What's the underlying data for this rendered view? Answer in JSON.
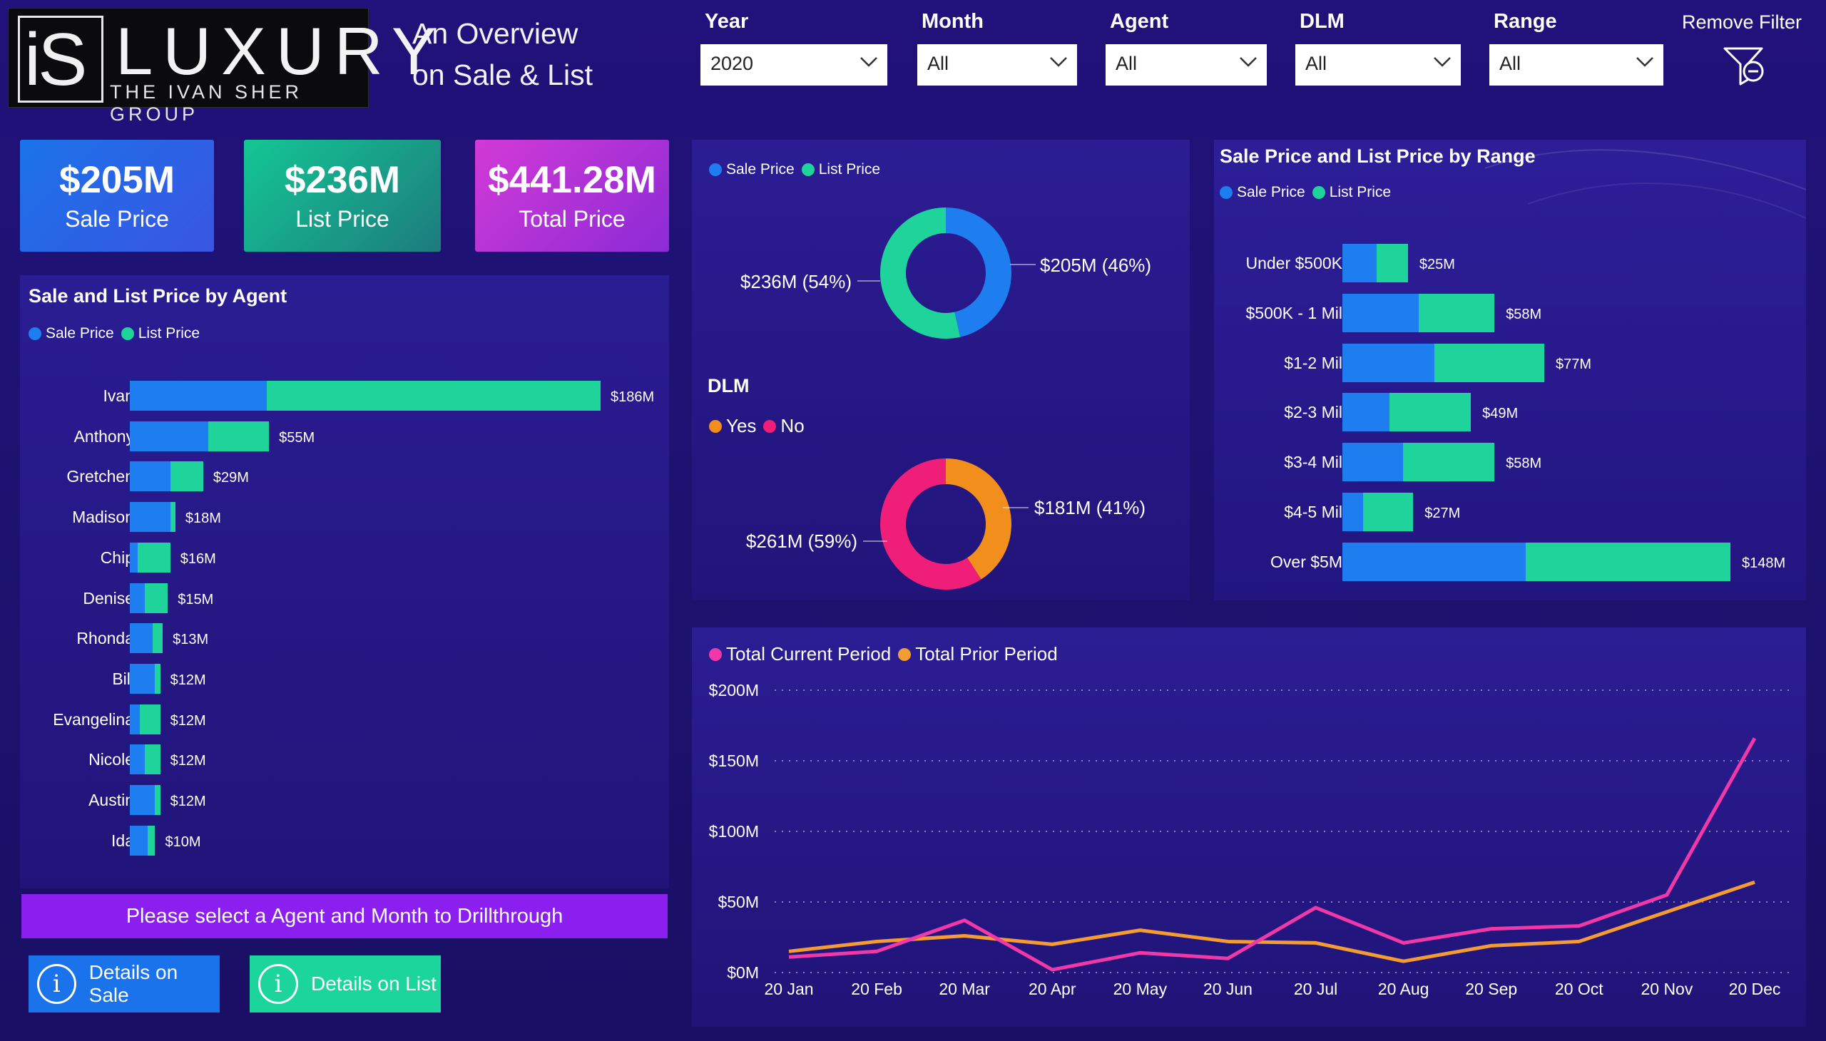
{
  "logo": {
    "mark": "iS",
    "name": "LUXURY",
    "subtitle": "THE IVAN SHER GROUP"
  },
  "header": {
    "title_line1": "An Overview",
    "title_line2": "on Sale & List"
  },
  "filters": [
    {
      "label": "Year",
      "value": "2020"
    },
    {
      "label": "Month",
      "value": "All"
    },
    {
      "label": "Agent",
      "value": "All"
    },
    {
      "label": "DLM",
      "value": "All"
    },
    {
      "label": "Range",
      "value": "All"
    }
  ],
  "remove_filter": {
    "label": "Remove Filter",
    "icon": "filter-remove-icon"
  },
  "kpis": [
    {
      "value": "$205M",
      "label": "Sale Price"
    },
    {
      "value": "$236M",
      "label": "List Price"
    },
    {
      "value": "$441.28M",
      "label": "Total Price"
    }
  ],
  "colors": {
    "sale": "#1e7ef0",
    "list": "#1fd49a",
    "yes": "#f28e1c",
    "no": "#ef1e78",
    "current": "#f038a8",
    "prior": "#f49b32",
    "cta": "#8a1ff0"
  },
  "agents_chart": {
    "title": "Sale and List Price by Agent",
    "legend": [
      "Sale Price",
      "List Price"
    ]
  },
  "price_donut": {
    "legend": [
      "Sale Price",
      "List Price"
    ]
  },
  "dlm_donut": {
    "title": "DLM",
    "legend": [
      "Yes",
      "No"
    ]
  },
  "range_chart": {
    "title": "Sale Price and List Price by Range",
    "legend": [
      "Sale Price",
      "List Price"
    ]
  },
  "line_legend": [
    "Total Current Period",
    "Total Prior Period"
  ],
  "cta": {
    "label": "Please select a Agent and Month to Drillthrough"
  },
  "buttons": {
    "sale": "Details on Sale",
    "list": "Details on List",
    "icon_glyph": "i"
  },
  "chart_data": [
    {
      "type": "bar",
      "title": "Sale and List Price by Agent",
      "orientation": "horizontal",
      "stacked": true,
      "categories": [
        "Ivan",
        "Anthony",
        "Gretchen",
        "Madison",
        "Chip",
        "Denise",
        "Rhonda",
        "Bill",
        "Evangelina",
        "Nicole",
        "Austin",
        "Ida"
      ],
      "series": [
        {
          "name": "Sale Price",
          "values": [
            54,
            31,
            16,
            16,
            3,
            6,
            9,
            10,
            4,
            6,
            10,
            7
          ]
        },
        {
          "name": "List Price",
          "values": [
            132,
            24,
            13,
            2,
            13,
            9,
            4,
            2,
            8,
            6,
            2,
            3
          ]
        }
      ],
      "totals": [
        "$186M",
        "$55M",
        "$29M",
        "$18M",
        "$16M",
        "$15M",
        "$13M",
        "$12M",
        "$12M",
        "$12M",
        "$12M",
        "$10M"
      ],
      "unit": "$M"
    },
    {
      "type": "pie",
      "donut": true,
      "legend": [
        "Sale Price",
        "List Price"
      ],
      "labels": [
        "Sale Price",
        "List Price"
      ],
      "values": [
        205,
        236
      ],
      "data_labels": [
        "$205M (46%)",
        "$236M (54%)"
      ]
    },
    {
      "type": "pie",
      "donut": true,
      "title": "DLM",
      "legend": [
        "Yes",
        "No"
      ],
      "labels": [
        "Yes",
        "No"
      ],
      "values": [
        181,
        261
      ],
      "data_labels": [
        "$181M (41%)",
        "$261M (59%)"
      ]
    },
    {
      "type": "bar",
      "title": "Sale Price and List Price by Range",
      "orientation": "horizontal",
      "stacked": true,
      "categories": [
        "Under $500K",
        "$500K - 1 Mil",
        "$1-2 Mil",
        "$2-3 Mil",
        "$3-4 Mil",
        "$4-5 Mil",
        "Over $5M"
      ],
      "series": [
        {
          "name": "Sale Price",
          "values": [
            13,
            29,
            35,
            18,
            23,
            8,
            70
          ]
        },
        {
          "name": "List Price",
          "values": [
            12,
            29,
            42,
            31,
            35,
            19,
            78
          ]
        }
      ],
      "totals": [
        "$25M",
        "$58M",
        "$77M",
        "$49M",
        "$58M",
        "$27M",
        "$148M"
      ],
      "unit": "$M"
    },
    {
      "type": "line",
      "x": [
        "20 Jan",
        "20 Feb",
        "20 Mar",
        "20 Apr",
        "20 May",
        "20 Jun",
        "20 Jul",
        "20 Aug",
        "20 Sep",
        "20 Oct",
        "20 Nov",
        "20 Dec"
      ],
      "series": [
        {
          "name": "Total Current Period",
          "values": [
            11,
            15,
            37,
            2,
            14,
            10,
            46,
            21,
            31,
            33,
            55,
            166
          ]
        },
        {
          "name": "Total Prior Period",
          "values": [
            15,
            22,
            26,
            20,
            30,
            22,
            21,
            8,
            19,
            22,
            43,
            64
          ]
        }
      ],
      "y_ticks": [
        "$0M",
        "$50M",
        "$100M",
        "$150M",
        "$200M"
      ],
      "ylim": [
        0,
        200
      ],
      "unit": "$M",
      "grid": "horizontal dotted"
    }
  ]
}
